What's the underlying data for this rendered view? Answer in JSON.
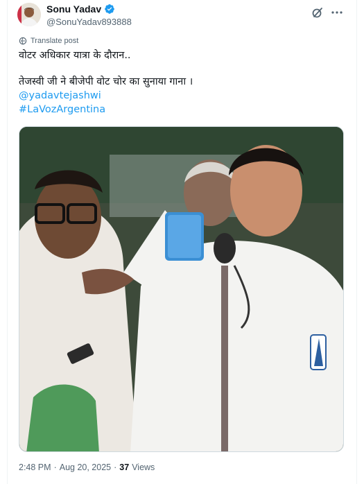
{
  "author": {
    "name": "Sonu Yadav",
    "handle": "@SonuYadav893888"
  },
  "translate_label": "Translate post",
  "tweet": {
    "line1": "वोटर अधिकार यात्रा के दौरान..",
    "line2": "तेजस्वी जी ने बीजेपी वोट चोर का सुनाया गाना ।",
    "mention": "@yadavtejashwi",
    "hashtag": "#LaVozArgentina"
  },
  "meta": {
    "time": "2:48 PM",
    "sep1": "·",
    "date": "Aug 20, 2025",
    "sep2": "·",
    "views_count": "37",
    "views_label": "Views"
  },
  "icons": {
    "verified": "verified-badge-icon",
    "grok": "grok-icon",
    "more": "more-icon",
    "translate": "translate-icon"
  },
  "colors": {
    "link": "#1d9bf0",
    "secondary_text": "#536471",
    "verified": "#1d9bf0"
  }
}
